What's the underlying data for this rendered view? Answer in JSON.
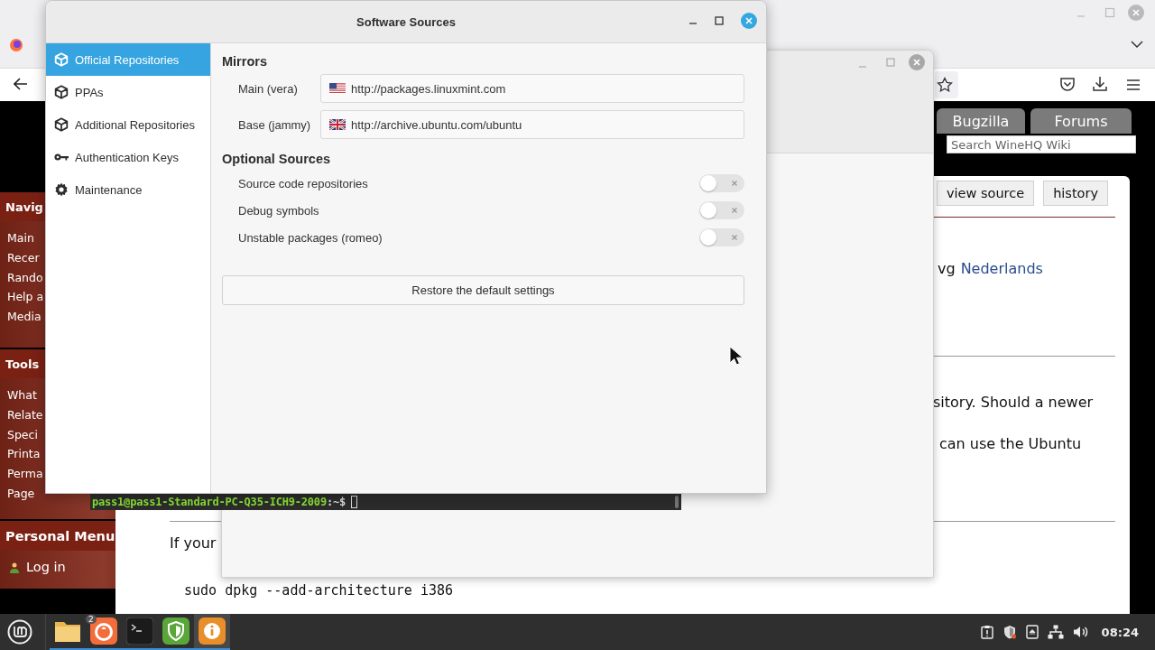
{
  "browser": {
    "wiki": {
      "portlets": [
        {
          "heading": "Navig",
          "items": [
            "Main",
            "Recer",
            "Rando",
            "Help a",
            "Media"
          ]
        },
        {
          "heading": "Tools",
          "items": [
            "What",
            "Relate",
            "Speci",
            "Printa",
            "Perma",
            "Page"
          ]
        },
        {
          "heading": "Personal Menu",
          "items": [
            "Log in"
          ]
        }
      ],
      "header_tabs": [
        "Bugzilla",
        "Forums"
      ],
      "search": {
        "placeholder": "Search WineHQ Wiki"
      },
      "actions": [
        "view source",
        "history"
      ],
      "language_line": {
        "text": "vg",
        "link": "Nederlands"
      },
      "paragraph_lines": [
        "sitory. Should a newer",
        "can use the Ubuntu"
      ],
      "intro": "If your",
      "command": "sudo dpkg --add-architecture i386"
    }
  },
  "terminal": {
    "user_host": "pass1@pass1-Standard-PC-Q35-ICH9-2009",
    "prompt": ":~$"
  },
  "dialog": {
    "title": "Software Sources",
    "sidebar": [
      {
        "label": "Official Repositories",
        "kind": "package",
        "selected": true
      },
      {
        "label": "PPAs",
        "kind": "package",
        "selected": false
      },
      {
        "label": "Additional Repositories",
        "kind": "package",
        "selected": false
      },
      {
        "label": "Authentication Keys",
        "kind": "key",
        "selected": false
      },
      {
        "label": "Maintenance",
        "kind": "gear",
        "selected": false
      }
    ],
    "mirrors": {
      "heading": "Mirrors",
      "rows": [
        {
          "label": "Main (vera)",
          "kind": "us",
          "url": "http://packages.linuxmint.com"
        },
        {
          "label": "Base (jammy)",
          "kind": "uk",
          "url": "http://archive.ubuntu.com/ubuntu"
        }
      ]
    },
    "optional": {
      "heading": "Optional Sources",
      "toggles": [
        {
          "label": "Source code repositories",
          "on": false
        },
        {
          "label": "Debug symbols",
          "on": false
        },
        {
          "label": "Unstable packages (romeo)",
          "on": false
        }
      ]
    },
    "restore_button": "Restore the default settings"
  },
  "taskbar": {
    "apps": [
      {
        "kind": "files",
        "selected": false
      },
      {
        "kind": "browser",
        "badge": "2",
        "selected": false
      },
      {
        "kind": "terminal",
        "selected": false
      },
      {
        "kind": "shield",
        "selected": false
      },
      {
        "kind": "info",
        "selected": true
      }
    ],
    "clock": "08:24"
  }
}
